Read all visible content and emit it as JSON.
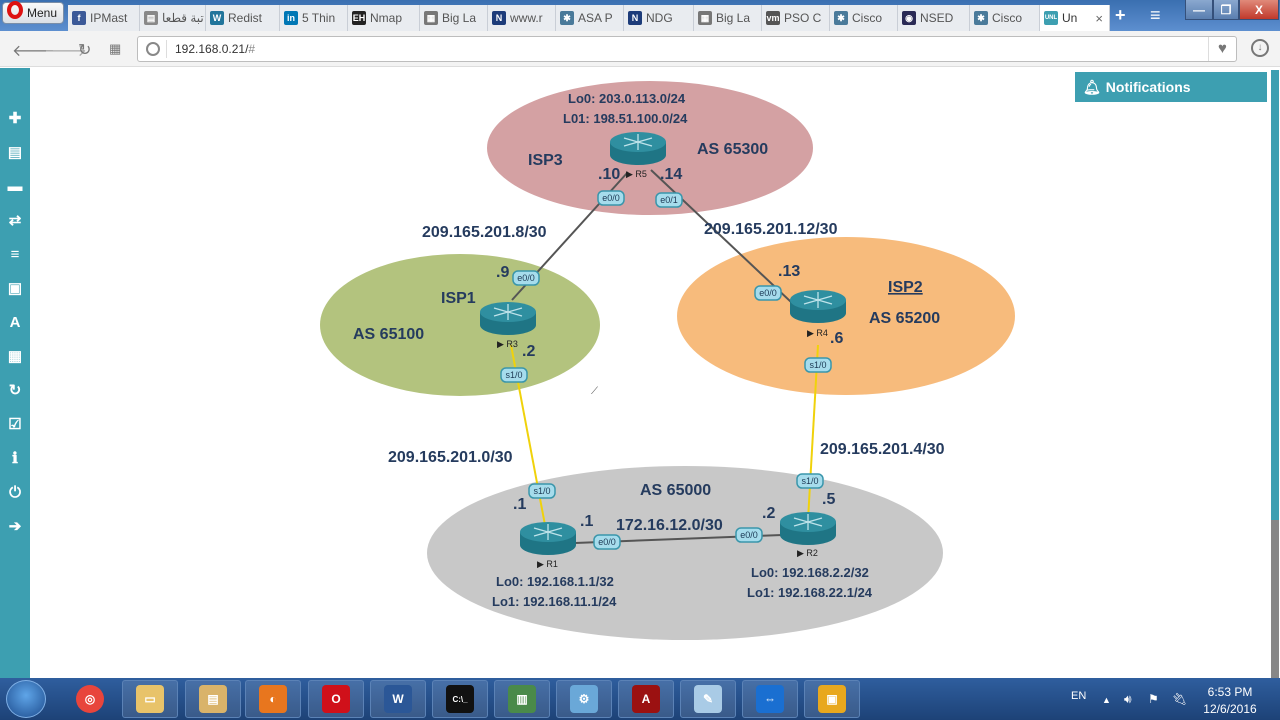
{
  "browser": {
    "menu_label": "Menu",
    "tabs": [
      {
        "label": "IPMast",
        "icon": "facebook-icon",
        "color": "#3b5998",
        "glyph": "f"
      },
      {
        "label": "تبة قطعا",
        "icon": "document-icon",
        "color": "#888888",
        "glyph": "▤"
      },
      {
        "label": "Redist",
        "icon": "wordpress-icon",
        "color": "#21759b",
        "glyph": "W"
      },
      {
        "label": "5 Thin",
        "icon": "linkedin-icon",
        "color": "#0077b5",
        "glyph": "in"
      },
      {
        "label": "Nmap",
        "icon": "ethical-hacking-icon",
        "color": "#222222",
        "glyph": "EH"
      },
      {
        "label": "Big La",
        "icon": "site-icon",
        "color": "#777777",
        "glyph": "▦"
      },
      {
        "label": "www.r",
        "icon": "n-icon",
        "color": "#1d3c7a",
        "glyph": "N"
      },
      {
        "label": "ASA P",
        "icon": "cisco-icon",
        "color": "#4a7a9a",
        "glyph": "✱"
      },
      {
        "label": "NDG",
        "icon": "n-icon",
        "color": "#1d3c7a",
        "glyph": "N"
      },
      {
        "label": "Big La",
        "icon": "site-icon",
        "color": "#777777",
        "glyph": "▦"
      },
      {
        "label": "PSO C",
        "icon": "vmware-icon",
        "color": "#555555",
        "glyph": "vm"
      },
      {
        "label": "Cisco",
        "icon": "cisco-icon",
        "color": "#4a7a9a",
        "glyph": "✱"
      },
      {
        "label": "NSED",
        "icon": "eye-icon",
        "color": "#2a2a55",
        "glyph": "◉"
      },
      {
        "label": "Cisco",
        "icon": "cisco-icon",
        "color": "#4a7a9a",
        "glyph": "✱"
      },
      {
        "label": "Un",
        "icon": "unl-icon",
        "color": "#3d9fb1",
        "glyph": "UNL",
        "active": true
      }
    ],
    "new_tab": "+",
    "tab_list": "≡",
    "window_buttons": {
      "minimize": "—",
      "restore": "❐",
      "close": "X"
    },
    "url": "192.168.0.21/",
    "url_hash": "#"
  },
  "sidebar": {
    "items": [
      {
        "name": "add-icon",
        "glyph": "✚"
      },
      {
        "name": "node-list-icon",
        "glyph": "▤"
      },
      {
        "name": "storage-icon",
        "glyph": "▬"
      },
      {
        "name": "network-icon",
        "glyph": "⇄"
      },
      {
        "name": "startup-config-icon",
        "glyph": "≡"
      },
      {
        "name": "picture-icon",
        "glyph": "▣"
      },
      {
        "name": "text-icon",
        "glyph": "A"
      },
      {
        "name": "grid-icon",
        "glyph": "▦"
      },
      {
        "name": "refresh-icon",
        "glyph": "↻"
      },
      {
        "name": "checkbox-icon",
        "glyph": "☑"
      },
      {
        "name": "info-icon",
        "glyph": "ℹ"
      },
      {
        "name": "power-icon",
        "glyph": "⏻"
      },
      {
        "name": "logout-icon",
        "glyph": "➔"
      }
    ]
  },
  "notifications": {
    "label": "Notifications"
  },
  "topology": {
    "colors": {
      "isp3": "#d4a1a3",
      "isp1": "#b3c37e",
      "isp2": "#f7bb7c",
      "as65000": "#c8c8c8",
      "router": "#2f8fa0",
      "serial_link": "#f0d20b",
      "eth_link": "#555555"
    },
    "areas": [
      {
        "id": "isp3",
        "name": "ISP3",
        "as": "AS 65300",
        "loopbacks": [
          "Lo0: 203.0.113.0/24",
          "L01: 198.51.100.0/24"
        ]
      },
      {
        "id": "isp1",
        "name": "ISP1",
        "as": "AS 65100"
      },
      {
        "id": "isp2",
        "name": "ISP2",
        "as": "AS 65200"
      },
      {
        "id": "as65000",
        "as": "AS 65000"
      }
    ],
    "routers": [
      {
        "id": "R5",
        "label": "R5"
      },
      {
        "id": "R3",
        "label": "R3"
      },
      {
        "id": "R4",
        "label": "R4"
      },
      {
        "id": "R1",
        "label": "R1",
        "loopbacks": [
          "Lo0: 192.168.1.1/32",
          "Lo1: 192.168.11.1/24"
        ]
      },
      {
        "id": "R2",
        "label": "R2",
        "loopbacks": [
          "Lo0: 192.168.2.2/32",
          "Lo1: 192.168.22.1/24"
        ]
      }
    ],
    "subnets": {
      "r5_r3": "209.165.201.8/30",
      "r5_r4": "209.165.201.12/30",
      "r3_r1": "209.165.201.0/30",
      "r4_r2": "209.165.201.4/30",
      "r1_r2": "172.16.12.0/30"
    },
    "interfaces": {
      "r5_e00": "e0/0",
      "r5_e01": "e0/1",
      "r3_e00": "e0/0",
      "r3_s10": "s1/0",
      "r4_e00": "e0/0",
      "r4_s10": "s1/0",
      "r1_s10": "s1/0",
      "r1_e00": "e0/0",
      "r2_s10": "s1/0",
      "r2_e00": "e0/0"
    },
    "host_ids": {
      "r5_e00": ".10",
      "r5_e01": ".14",
      "r3_e00": ".9",
      "r3_s10": ".2",
      "r4_e00": ".13",
      "r4_s10": ".6",
      "r1_s10": ".1",
      "r1_e00": ".1",
      "r2_e00": ".2",
      "r2_s10": ".5"
    }
  },
  "taskbar": {
    "apps": [
      {
        "name": "chrome-icon",
        "color": "#e8453c",
        "glyph": "◎"
      },
      {
        "name": "file-explorer-icon",
        "color": "#e8c36a",
        "glyph": "▭"
      },
      {
        "name": "documents-icon",
        "color": "#d9b36a",
        "glyph": "▤"
      },
      {
        "name": "firefox-icon",
        "color": "#e8761e",
        "glyph": "◐"
      },
      {
        "name": "opera-icon",
        "color": "#d0101a",
        "glyph": "O"
      },
      {
        "name": "word-icon",
        "color": "#2b5797",
        "glyph": "W"
      },
      {
        "name": "cmd-icon",
        "color": "#111111",
        "glyph": "C:\\_"
      },
      {
        "name": "task-manager-icon",
        "color": "#4a8a4a",
        "glyph": "▥"
      },
      {
        "name": "control-panel-icon",
        "color": "#6aa8d8",
        "glyph": "⚙"
      },
      {
        "name": "acrobat-icon",
        "color": "#9b1111",
        "glyph": "A"
      },
      {
        "name": "notepad-icon",
        "color": "#a9cbe6",
        "glyph": "✎"
      },
      {
        "name": "teamviewer-icon",
        "color": "#1a6fd1",
        "glyph": "⇔"
      },
      {
        "name": "vmware-icon",
        "color": "#e8a81e",
        "glyph": "▣"
      }
    ],
    "tray": {
      "language": "EN",
      "time": "6:53 PM",
      "date": "12/6/2016"
    }
  }
}
